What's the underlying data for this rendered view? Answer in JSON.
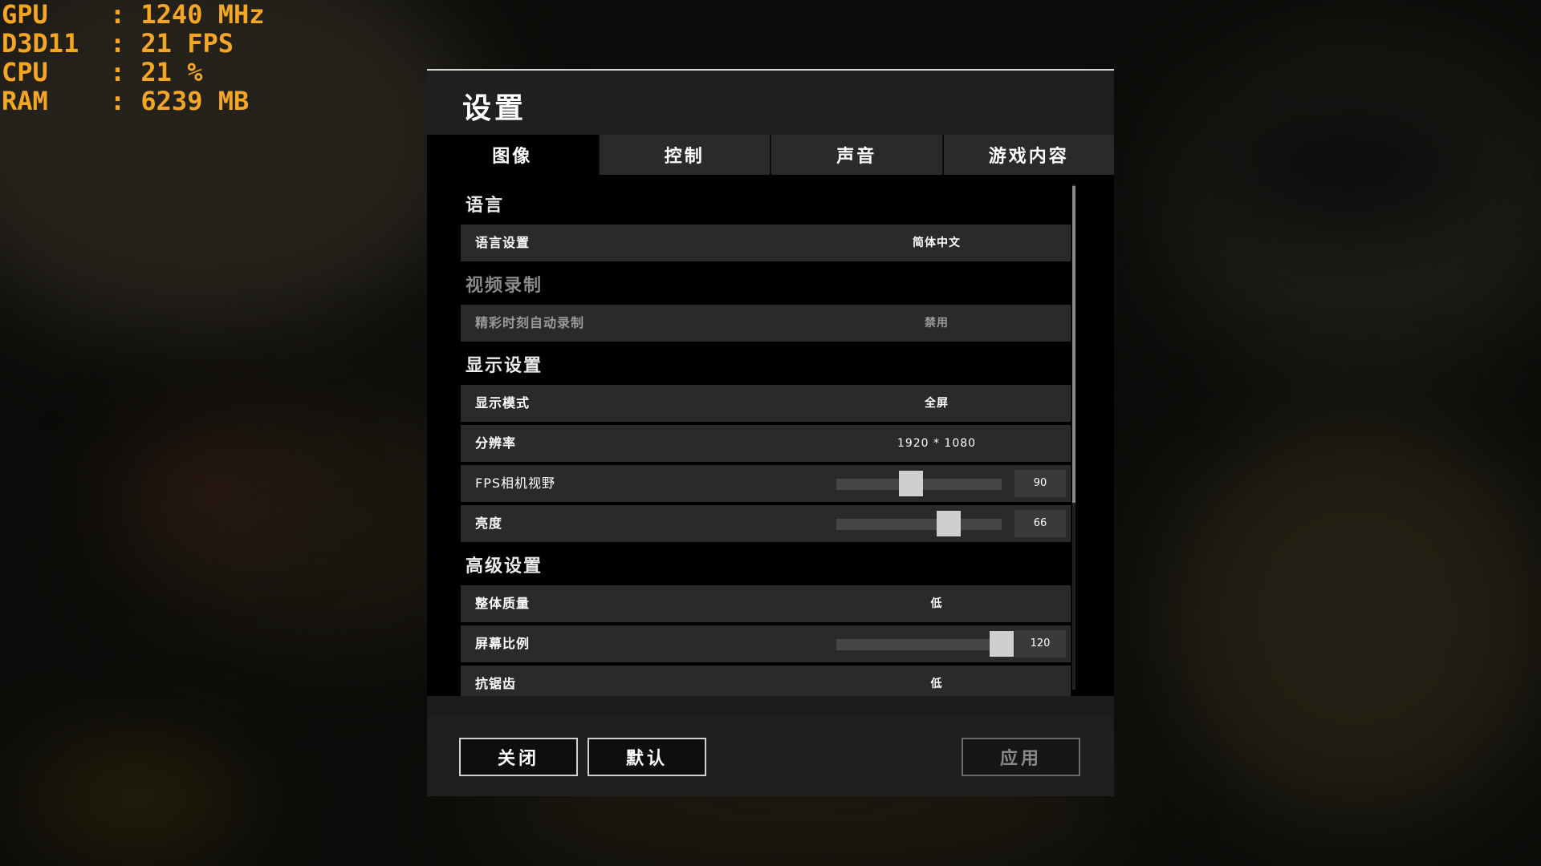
{
  "hud": {
    "gpu": "GPU    : 1240 MHz",
    "d3d": "D3D11  : 21 FPS",
    "cpu": "CPU    : 21 %",
    "ram": "RAM    : 6239 MB"
  },
  "dialog": {
    "title": "设置",
    "tabs": [
      {
        "label": "图像"
      },
      {
        "label": "控制"
      },
      {
        "label": "声音"
      },
      {
        "label": "游戏内容"
      }
    ],
    "active_tab": "图像"
  },
  "sections": {
    "language": "语言",
    "recording": "视频录制",
    "display": "显示设置",
    "advanced": "高级设置"
  },
  "rows": {
    "language_setting": {
      "label": "语言设置",
      "value": "简体中文"
    },
    "auto_record": {
      "label": "精彩时刻自动录制",
      "value": "禁用"
    },
    "display_mode": {
      "label": "显示模式",
      "value": "全屏"
    },
    "resolution": {
      "label": "分辨率",
      "value": "1920 * 1080"
    },
    "fov": {
      "label": "FPS相机视野",
      "value": "90",
      "fraction": 0.45
    },
    "brightness": {
      "label": "亮度",
      "value": "66",
      "fraction": 0.68
    },
    "overall_quality": {
      "label": "整体质量",
      "value": "低"
    },
    "screen_scale": {
      "label": "屏幕比例",
      "value": "120",
      "fraction": 1.0
    },
    "anti_aliasing": {
      "label": "抗锯齿",
      "value": "低"
    }
  },
  "footer": {
    "close": "关闭",
    "default": "默认",
    "apply": "应用"
  },
  "colors": {
    "hud": "#f5a623",
    "dialog_bg": "#1c1c1c",
    "row_bg": "#2a2a2a",
    "slider_thumb": "#cfcfcf"
  }
}
